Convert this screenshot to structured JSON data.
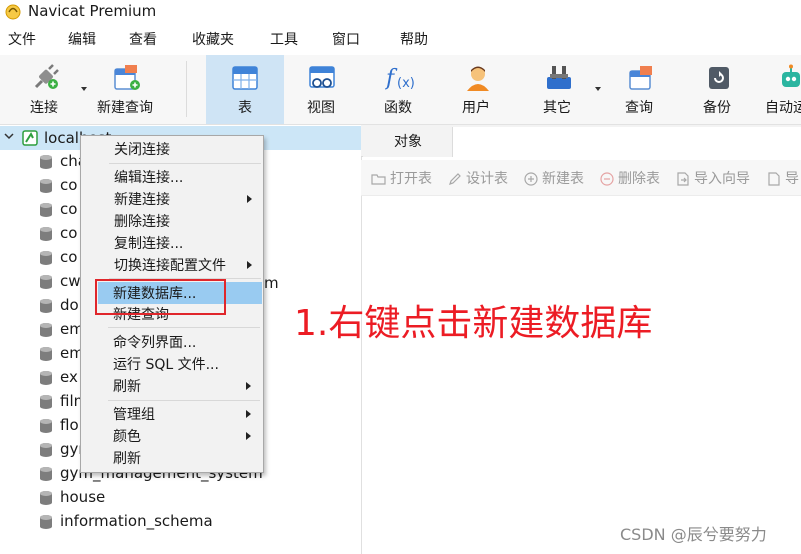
{
  "window": {
    "title": "Navicat Premium"
  },
  "menubar": [
    "文件",
    "编辑",
    "查看",
    "收藏夹",
    "工具",
    "窗口",
    "帮助"
  ],
  "toolbar": {
    "connect": "连接",
    "new_query": "新建查询",
    "table": "表",
    "view": "视图",
    "function": "函数",
    "user": "用户",
    "other": "其它",
    "query": "查询",
    "backup": "备份",
    "auto": "自动运"
  },
  "tree": {
    "connection": "localhost",
    "databases": [
      "cha",
      "co",
      "co",
      "co",
      "co",
      "cw",
      "do",
      "em",
      "em",
      "ex",
      "film",
      "flo",
      "gym",
      "gym_management_system",
      "house",
      "information_schema"
    ],
    "partial_right_text": "m"
  },
  "objects_tab": {
    "label": "对象"
  },
  "object_toolbar": [
    "打开表",
    "设计表",
    "新建表",
    "删除表",
    "导入向导",
    "导"
  ],
  "context_menu": {
    "close_connection": "关闭连接",
    "edit_connection": "编辑连接...",
    "new_connection": "新建连接",
    "delete_connection": "删除连接",
    "copy_connection": "复制连接...",
    "switch_profile": "切换连接配置文件",
    "new_database": "新建数据库...",
    "new_query": "新建查询",
    "command_console": "命令列界面...",
    "run_sql_file": "运行 SQL 文件...",
    "refresh": "刷新",
    "manage_group": "管理组",
    "color": "颜色",
    "refresh2": "刷新"
  },
  "annotation": "1.右键点击新建数据库",
  "watermark": "CSDN @辰兮要努力",
  "colors": {
    "accent": "#cce6f7",
    "highlight": "#99cbf1",
    "annotation": "#ec1c24"
  }
}
